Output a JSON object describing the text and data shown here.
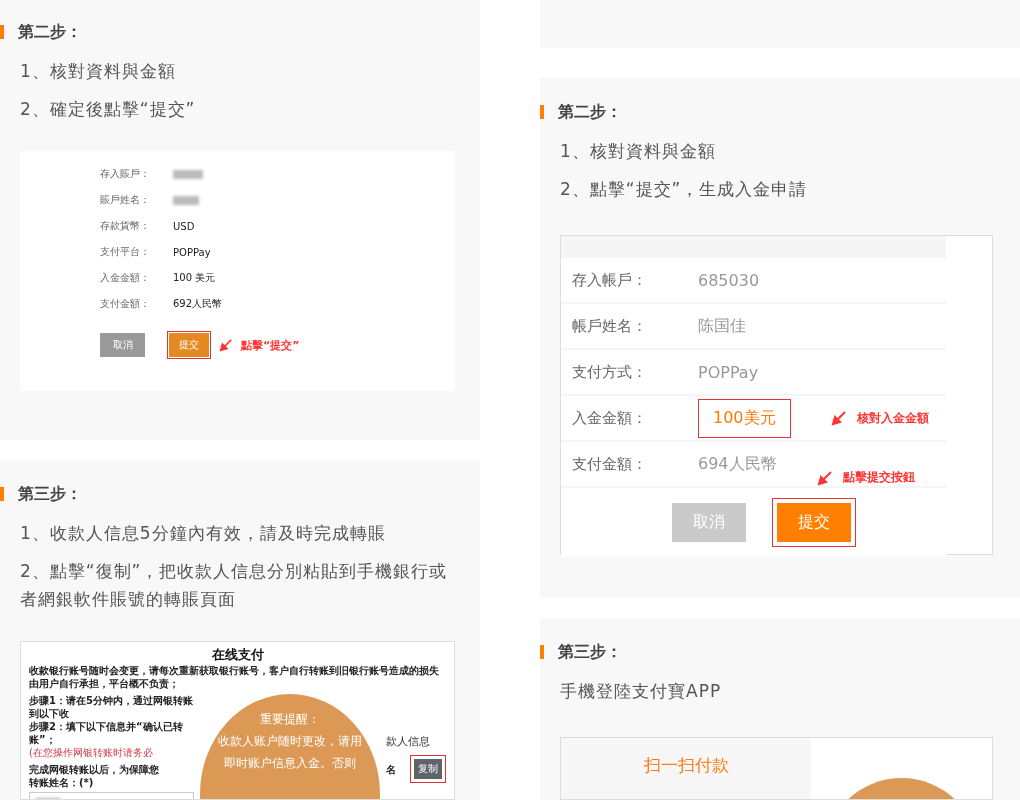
{
  "left": {
    "sections": [
      {
        "heading": "第二步：",
        "items": [
          "1、核對資料與金額",
          "2、確定後點擊“提交”"
        ],
        "figure": {
          "kind": "form",
          "rows": [
            {
              "label": "存入賬戶：",
              "blurred": true
            },
            {
              "label": "賬戶姓名：",
              "blurred": true
            },
            {
              "label": "存款貨幣：",
              "blurred": false,
              "value": "USD"
            },
            {
              "label": "支付平台：",
              "blurred": false,
              "value": "POPPay"
            },
            {
              "label": "入金金額：",
              "blurred": false,
              "value": "100 美元"
            },
            {
              "label": "支付金額：",
              "blurred": false,
              "value": "692人民幣"
            }
          ],
          "cancel": "取消",
          "submit": "提交",
          "note": "點擊“提交”"
        }
      },
      {
        "heading": "第三步：",
        "items": [
          "1、收款人信息5分鐘內有效，請及時完成轉賬",
          "2、點擊“復制”，把收款人信息分別粘貼到手機銀行或者網銀軟件賬號的轉賬頁面"
        ],
        "figure": {
          "kind": "online_payment",
          "title": "在线支付",
          "notice": "收款银行账号随时会变更，请每次重新获取银行账号，客户自行转账到旧银行账号造成的损失由用户自行承担，平台概不负责；",
          "steps": [
            "步骤1：请在5分钟内，通过网银转账到以下收",
            "步骤2：填下以下信息并“确认已转账”；"
          ],
          "warning": "(在您操作网银转账时请务必",
          "prompt": "完成网银转账以后，为保障您",
          "field_label": "转账姓名：(*)",
          "side_heading": "款人信息",
          "side_label": "名",
          "copy": "复制",
          "overlay": {
            "title": "重要提醒：",
            "lines": [
              "收款人账户随时更改，请用",
              "即时账户信息入金。否则"
            ]
          }
        }
      }
    ]
  },
  "right": {
    "sections": [
      {
        "kind": "blank"
      },
      {
        "kind": "step",
        "heading": "第二步：",
        "items": [
          "1、核對資料與金額",
          "2、點擊“提交”，生成入金申請"
        ],
        "figure": {
          "kind": "form2",
          "rows": [
            {
              "label": "存入帳戶：",
              "value": "685030",
              "highlight": false
            },
            {
              "label": "帳戶姓名：",
              "value": "陈国佳",
              "highlight": false
            },
            {
              "label": "支付方式：",
              "value": "POPPay",
              "highlight": false
            },
            {
              "label": "入金金額：",
              "value": "100美元",
              "highlight": true,
              "note": "核對入金金額"
            },
            {
              "label": "支付金額：",
              "value": "694人民幣",
              "highlight": false,
              "note": "點擊提交按鈕"
            }
          ],
          "cancel": "取消",
          "submit": "提交"
        }
      },
      {
        "kind": "step",
        "heading": "第三步：",
        "items": [
          "手機登陸支付寶APP"
        ],
        "figure": {
          "kind": "qr",
          "caption": "扫一扫付款"
        }
      }
    ]
  }
}
